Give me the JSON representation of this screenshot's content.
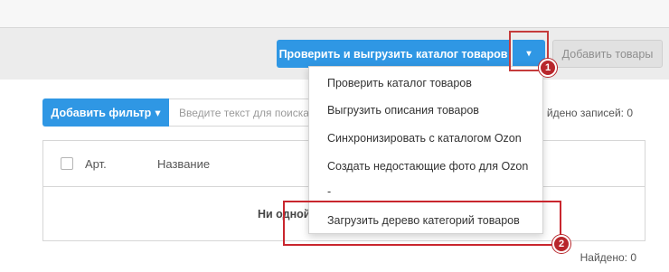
{
  "toolbar": {
    "export_button_label": "Проверить и выгрузить каталог товаров",
    "caret_icon": "▾",
    "add_goods_label": "Добавить товары"
  },
  "dropdown": {
    "items": [
      "Проверить каталог товаров",
      "Выгрузить описания товаров",
      "Синхронизировать с каталогом Ozon",
      "Создать недостающие фото для Ozon",
      "-",
      "Загрузить дерево категорий товаров"
    ]
  },
  "annotations": {
    "badge1": "1",
    "badge2": "2",
    "highlight_color": "#c9262e"
  },
  "filter": {
    "add_filter_label": "Добавить фильтр",
    "caret_icon": "▾",
    "search_placeholder": "Введите текст для поиска",
    "records_found": "йдено записей: 0"
  },
  "table": {
    "columns": [
      "Арт.",
      "Название"
    ],
    "empty_message": "Ни одной"
  },
  "footer": {
    "found": "Найдено: 0"
  },
  "colors": {
    "primary": "#2f97e4",
    "disabled_button": "#e1e1e1",
    "badge": "#b8262b"
  }
}
